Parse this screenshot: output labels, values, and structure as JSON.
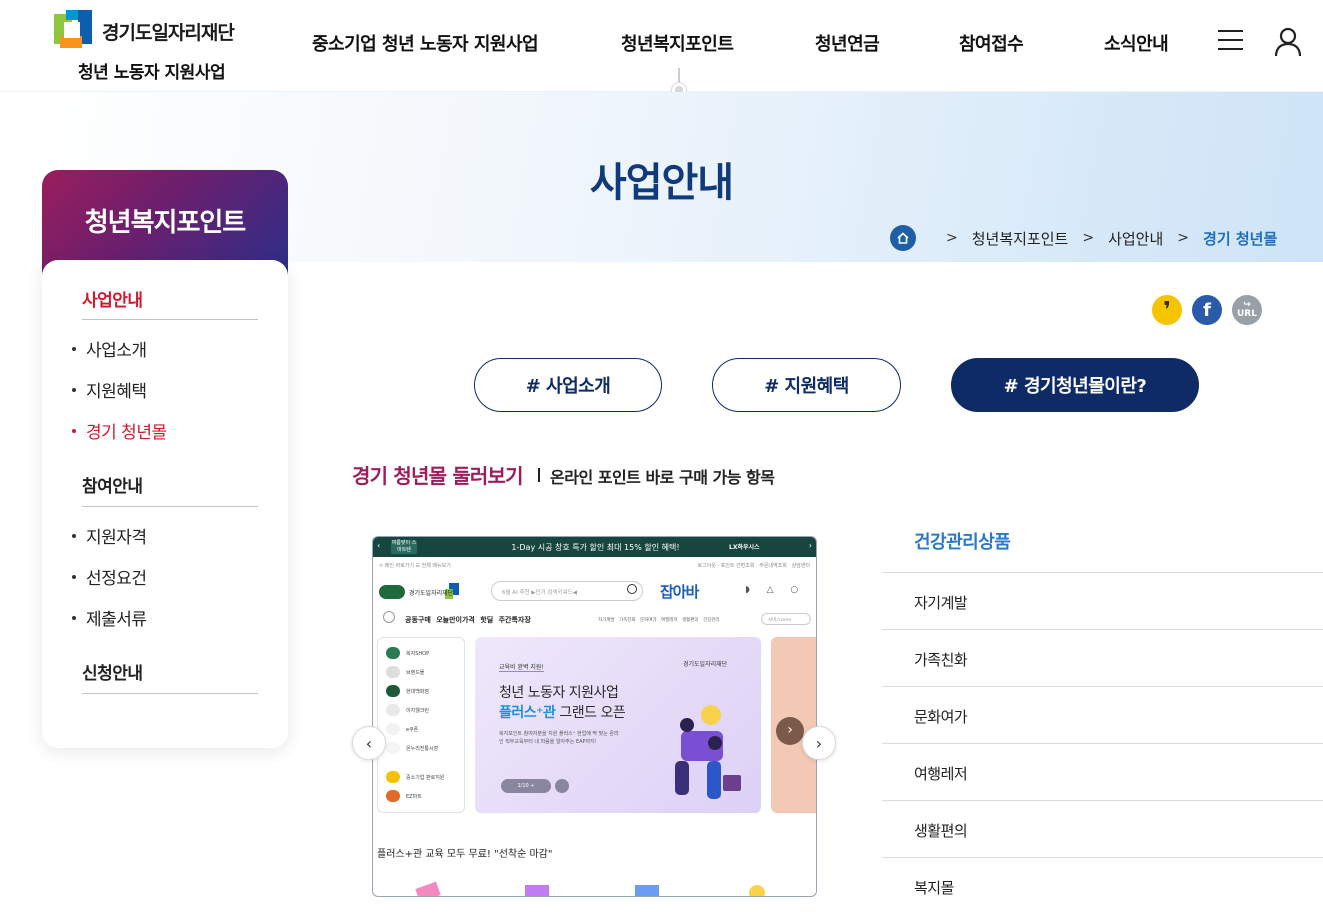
{
  "header": {
    "logo_org": "경기도일자리재단",
    "logo_sub": "청년 노동자 지원사업",
    "nav": [
      "중소기업 청년 노동자 지원사업",
      "청년복지포인트",
      "청년연금",
      "참여접수",
      "소식안내"
    ]
  },
  "hero": {
    "title": "사업안내",
    "breadcrumb": [
      "청년복지포인트",
      "사업안내",
      "경기 청년몰"
    ]
  },
  "sidebar": {
    "title": "청년복지포인트",
    "groups": [
      {
        "label": "사업안내",
        "items": [
          "사업소개",
          "지원혜택",
          "경기 청년몰"
        ]
      },
      {
        "label": "참여안내",
        "items": [
          "지원자격",
          "선정요건",
          "제출서류"
        ]
      },
      {
        "label": "신청안내",
        "items": []
      }
    ]
  },
  "share": {
    "kakao": "❜",
    "facebook": "f",
    "url": "URL"
  },
  "tabs": [
    "# 사업소개",
    "# 지원혜택",
    "# 경기청년몰이란?"
  ],
  "section": {
    "title": "경기 청년몰 둘러보기",
    "subtitle": "온라인 포인트 바로 구매 가능 항목"
  },
  "preview": {
    "topbar_badge": "여름맞이 스마트텐",
    "topbar_msg": "1-Day 시공 창호 특가 할인  최대 15% 할인 혜택!",
    "topbar_right": "LX하우시스",
    "util_left": "< 메인 바로가기   ☰ 전체 메뉴보기",
    "util_right": "로그아웃 · 포인트 간편조회 · 주문내역조회 · 상담센터",
    "logo_text": "경기도일자리재단",
    "search_placeholder": "6월 AI 추천 ▶인기 검색키워드◀",
    "brand": "잡아바",
    "nav_items": "공동구매  오늘만이가격  핫딜  주간특자장",
    "nav_cats": "자기계발 가족친화 문화여가 여행레저 생활편의 건강관리",
    "nav_select": "서비스zone",
    "side_items": [
      "복지SHOP",
      "브랜드몰",
      "현대백화점",
      "이지웰크린",
      "e쿠폰",
      "온누리전통시장",
      "중소기업 판로지원",
      "EZ마트"
    ],
    "banner_tag": "교육비 완벽 지원!",
    "banner_logo": "경기도일자리재단",
    "banner_line1": "청년 노동자 지원사업",
    "banner_line2_hl": "플러스⁺관",
    "banner_line2_rest": " 그랜드 오픈",
    "banner_desc": "복지포인트 참여자분을 지원 플러스⁺ 현업에 딱 맞는 온라인 직무교육부터 내 마음을 알아주는 EAP까지!",
    "banner_pager": "1/10 +",
    "notice": "플러스+관 교육 모두 무료! \"선착순 마감\""
  },
  "categories": {
    "head": "건강관리상품",
    "items": [
      "자기계발",
      "가족친화",
      "문화여가",
      "여행레저",
      "생활편의",
      "복지몰"
    ]
  },
  "colors": {
    "navy": "#0f2b66",
    "accent_red": "#d0192e",
    "accent_magenta": "#9b1d5c",
    "link_blue": "#2a78c8"
  }
}
